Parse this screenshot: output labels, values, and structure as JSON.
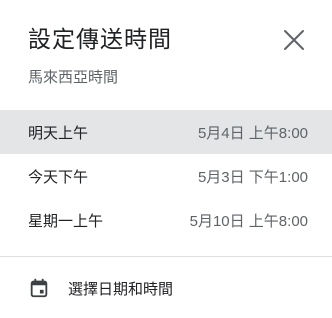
{
  "dialog": {
    "title": "設定傳送時間",
    "timezone": "馬來西亞時間",
    "close_icon": "close-icon"
  },
  "options": [
    {
      "label": "明天上午",
      "time": "5月4日 上午8:00",
      "highlighted": true
    },
    {
      "label": "今天下午",
      "time": "5月3日 下午1:00",
      "highlighted": false
    },
    {
      "label": "星期一上午",
      "time": "5月10日 上午8:00",
      "highlighted": false
    }
  ],
  "picker": {
    "icon": "calendar-icon",
    "label": "選擇日期和時間"
  }
}
